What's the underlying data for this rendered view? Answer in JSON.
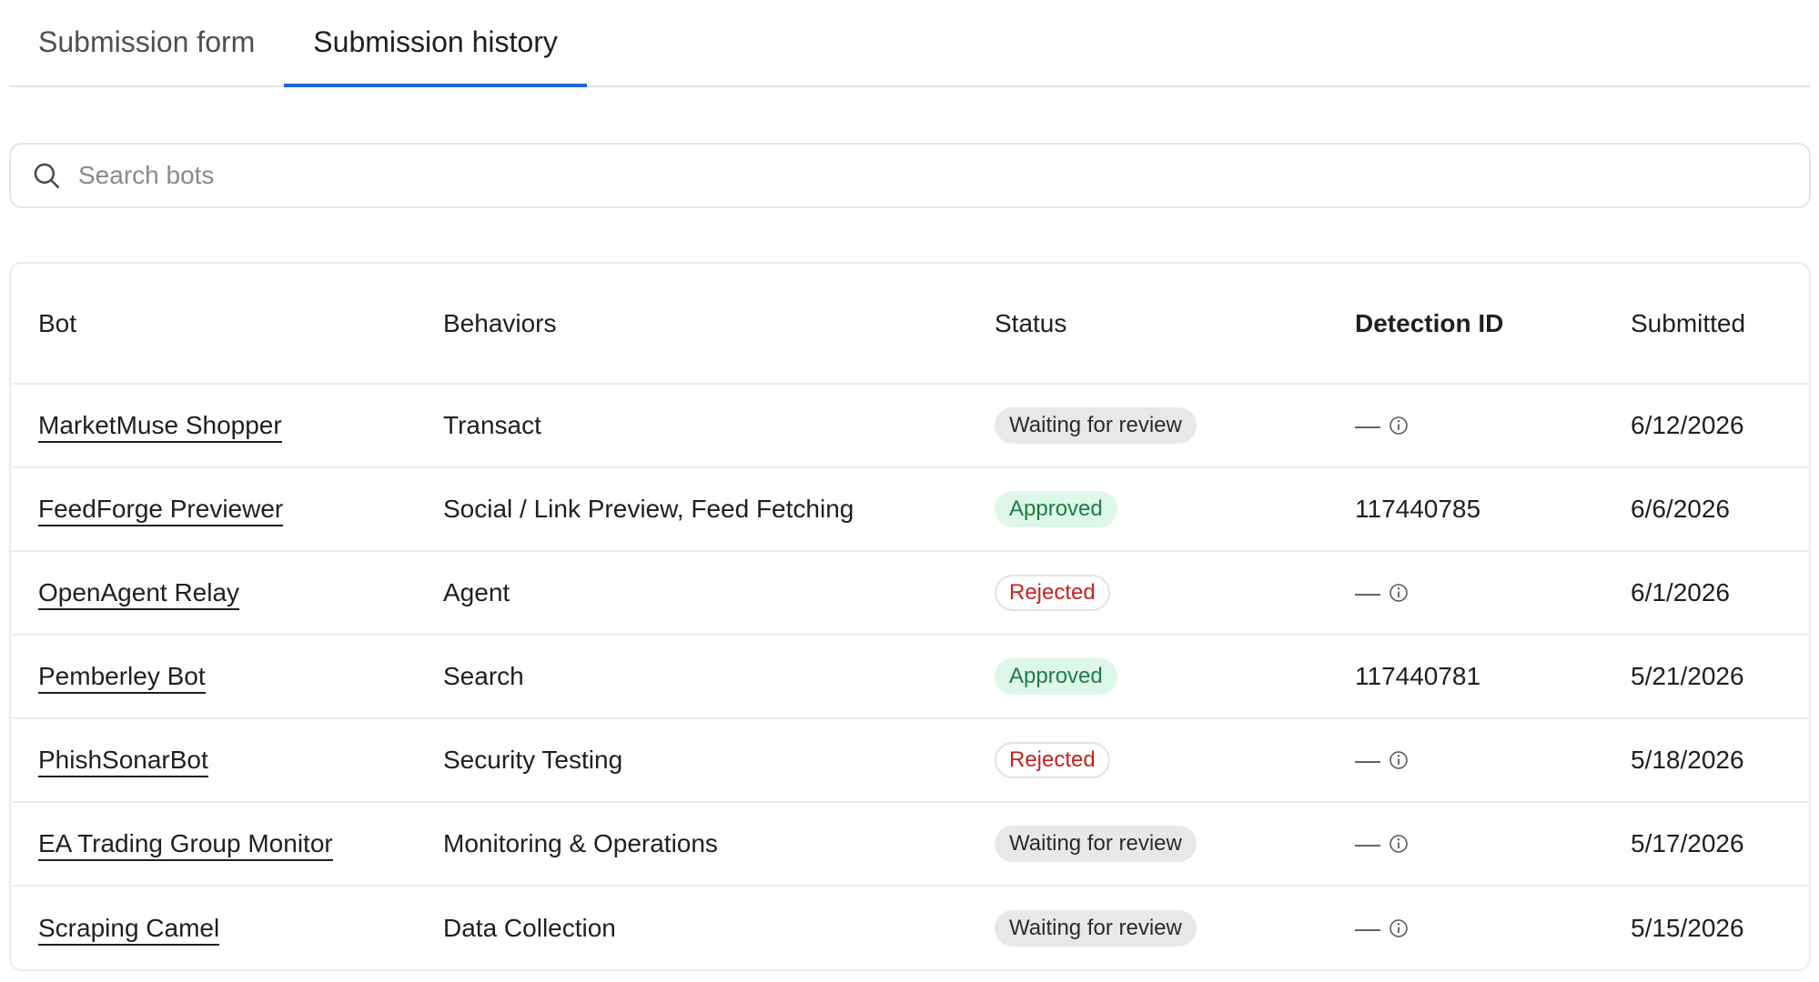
{
  "tabs": [
    {
      "label": "Submission form",
      "active": false
    },
    {
      "label": "Submission history",
      "active": true
    }
  ],
  "search": {
    "placeholder": "Search bots",
    "value": ""
  },
  "table": {
    "headers": {
      "bot": "Bot",
      "behaviors": "Behaviors",
      "status": "Status",
      "detection_id": "Detection ID",
      "submitted": "Submitted"
    },
    "rows": [
      {
        "bot": "MarketMuse Shopper",
        "behaviors": "Transact",
        "status": "Waiting for review",
        "status_kind": "waiting",
        "detection_id": "—",
        "submitted": "6/12/2026"
      },
      {
        "bot": "FeedForge Previewer",
        "behaviors": "Social / Link Preview, Feed Fetching",
        "status": "Approved",
        "status_kind": "approved",
        "detection_id": "117440785",
        "submitted": "6/6/2026"
      },
      {
        "bot": "OpenAgent Relay",
        "behaviors": "Agent",
        "status": "Rejected",
        "status_kind": "rejected",
        "detection_id": "—",
        "submitted": "6/1/2026"
      },
      {
        "bot": "Pemberley Bot",
        "behaviors": "Search",
        "status": "Approved",
        "status_kind": "approved",
        "detection_id": "117440781",
        "submitted": "5/21/2026"
      },
      {
        "bot": "PhishSonarBot",
        "behaviors": "Security Testing",
        "status": "Rejected",
        "status_kind": "rejected",
        "detection_id": "—",
        "submitted": "5/18/2026"
      },
      {
        "bot": "EA Trading Group Monitor",
        "behaviors": "Monitoring & Operations",
        "status": "Waiting for review",
        "status_kind": "waiting",
        "detection_id": "—",
        "submitted": "5/17/2026"
      },
      {
        "bot": "Scraping Camel",
        "behaviors": "Data Collection",
        "status": "Waiting for review",
        "status_kind": "waiting",
        "detection_id": "—",
        "submitted": "5/15/2026"
      }
    ]
  },
  "colors": {
    "accent": "#1967d2",
    "approved_bg": "#ddf7e9",
    "approved_text": "#1e7d45",
    "rejected_text": "#c5221f",
    "waiting_bg": "#e8e8e8"
  },
  "icons": {
    "search": "search-icon",
    "info": "info-icon"
  }
}
